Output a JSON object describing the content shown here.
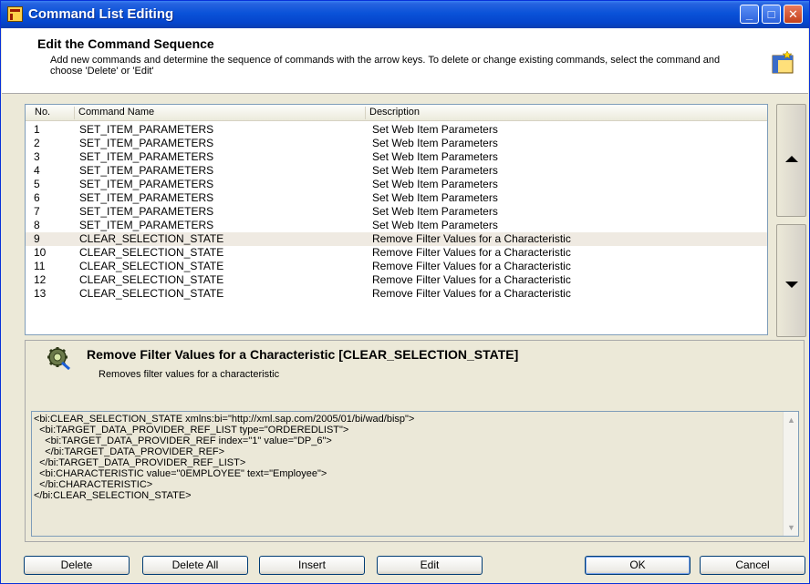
{
  "window": {
    "title": "Command List Editing",
    "controls": {
      "minimize": "_",
      "maximize": "□",
      "close": "✕"
    }
  },
  "header": {
    "title": "Edit the Command Sequence",
    "description": "Add new commands and determine the sequence of commands with the arrow keys. To delete or change existing commands, select the command and choose 'Delete' or 'Edit'"
  },
  "table": {
    "columns": [
      "No.",
      "Command Name",
      "Description"
    ],
    "rows": [
      {
        "no": "1",
        "name": "SET_ITEM_PARAMETERS",
        "desc": "Set Web Item Parameters"
      },
      {
        "no": "2",
        "name": "SET_ITEM_PARAMETERS",
        "desc": "Set Web Item Parameters"
      },
      {
        "no": "3",
        "name": "SET_ITEM_PARAMETERS",
        "desc": "Set Web Item Parameters"
      },
      {
        "no": "4",
        "name": "SET_ITEM_PARAMETERS",
        "desc": "Set Web Item Parameters"
      },
      {
        "no": "5",
        "name": "SET_ITEM_PARAMETERS",
        "desc": "Set Web Item Parameters"
      },
      {
        "no": "6",
        "name": "SET_ITEM_PARAMETERS",
        "desc": "Set Web Item Parameters"
      },
      {
        "no": "7",
        "name": "SET_ITEM_PARAMETERS",
        "desc": "Set Web Item Parameters"
      },
      {
        "no": "8",
        "name": "SET_ITEM_PARAMETERS",
        "desc": "Set Web Item Parameters"
      },
      {
        "no": "9",
        "name": "CLEAR_SELECTION_STATE",
        "desc": "Remove Filter Values for a Characteristic"
      },
      {
        "no": "10",
        "name": "CLEAR_SELECTION_STATE",
        "desc": "Remove Filter Values for a Characteristic"
      },
      {
        "no": "11",
        "name": "CLEAR_SELECTION_STATE",
        "desc": "Remove Filter Values for a Characteristic"
      },
      {
        "no": "12",
        "name": "CLEAR_SELECTION_STATE",
        "desc": "Remove Filter Values for a Characteristic"
      },
      {
        "no": "13",
        "name": "CLEAR_SELECTION_STATE",
        "desc": "Remove Filter Values for a Characteristic"
      }
    ],
    "selected_row": "9"
  },
  "detail": {
    "title": "Remove Filter Values for a Characteristic [CLEAR_SELECTION_STATE]",
    "subtitle": "Removes filter values for a characteristic",
    "xml": "<bi:CLEAR_SELECTION_STATE xmlns:bi=\"http://xml.sap.com/2005/01/bi/wad/bisp\">\n  <bi:TARGET_DATA_PROVIDER_REF_LIST type=\"ORDEREDLIST\">\n    <bi:TARGET_DATA_PROVIDER_REF index=\"1\" value=\"DP_6\">\n    </bi:TARGET_DATA_PROVIDER_REF>\n  </bi:TARGET_DATA_PROVIDER_REF_LIST>\n  <bi:CHARACTERISTIC value=\"0EMPLOYEE\" text=\"Employee\">\n  </bi:CHARACTERISTIC>\n</bi:CLEAR_SELECTION_STATE>"
  },
  "buttons": {
    "delete": "Delete",
    "delete_all": "Delete All",
    "insert": "Insert",
    "edit": "Edit",
    "ok": "OK",
    "cancel": "Cancel"
  },
  "icons": {
    "app": "command-list-icon",
    "header": "command-list-large-icon",
    "detail": "gear-icon",
    "move_up": "arrow-up-icon",
    "move_down": "arrow-down-icon"
  },
  "colors": {
    "titlebar": "#0a52d8",
    "dialog_bg": "#ece9d8",
    "selected_row": "#efeae2"
  }
}
